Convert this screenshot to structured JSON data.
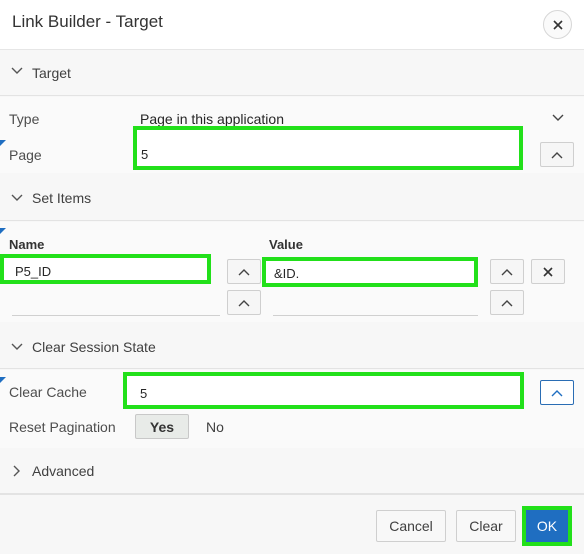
{
  "dialog": {
    "title": "Link Builder - Target",
    "close_icon": "close-icon"
  },
  "sections": {
    "target": "Target",
    "set_items": "Set Items",
    "clear_session_state": "Clear Session State",
    "advanced": "Advanced"
  },
  "target": {
    "type_label": "Type",
    "type_value": "Page in this application",
    "page_label": "Page",
    "page_value": "5"
  },
  "set_items": {
    "name_header": "Name",
    "value_header": "Value",
    "rows": [
      {
        "name": "P5_ID",
        "value": "&ID."
      },
      {
        "name": "",
        "value": ""
      }
    ]
  },
  "clear_session": {
    "clear_cache_label": "Clear Cache",
    "clear_cache_value": "5",
    "reset_pagination_label": "Reset Pagination",
    "yes": "Yes",
    "no": "No",
    "selected": "Yes"
  },
  "footer": {
    "cancel": "Cancel",
    "clear": "Clear",
    "ok": "OK"
  },
  "colors": {
    "accent": "#1f6ec1",
    "highlight": "#22e01a"
  }
}
